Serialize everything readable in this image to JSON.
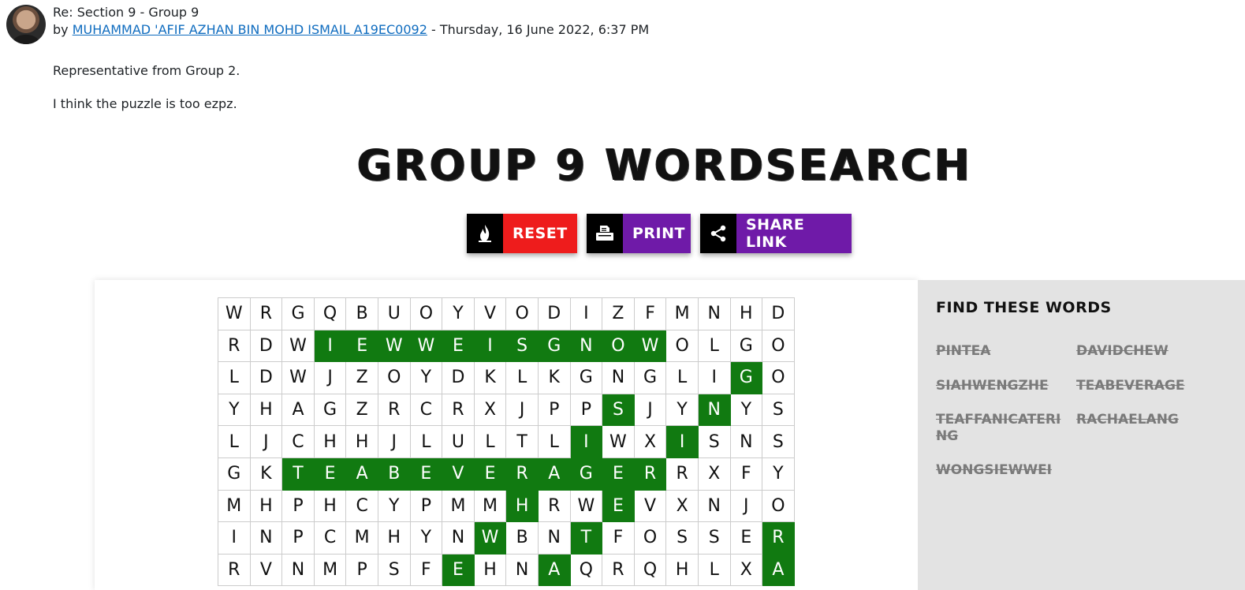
{
  "post": {
    "subject": "Re: Section 9 - Group 9",
    "by_prefix": "by",
    "author": "MUHAMMAD 'AFIF AZHAN BIN MOHD ISMAIL A19EC0092",
    "date": "- Thursday, 16 June 2022, 6:37 PM",
    "paragraphs": [
      "Representative from Group 2.",
      "I think the puzzle is too ezpz."
    ]
  },
  "wordsearch": {
    "title": "GROUP 9 WORDSEARCH",
    "buttons": {
      "reset": {
        "label": "RESET",
        "icon": "fire-icon",
        "color": "#ee1c1c"
      },
      "print": {
        "label": "PRINT",
        "icon": "printer-icon",
        "color": "#6f1aa8"
      },
      "share": {
        "label": "SHARE LINK",
        "icon": "share-icon",
        "color": "#6f1aa8"
      }
    },
    "highlight_color": "#117a11",
    "grid": [
      "WRGQBUOYVODIZFMNHD",
      "RDWIEWWEISGNOWOLGO",
      "LDWJZOYDKLKGNGLIGO",
      "YHAGZRCRXJPPSJYNYS",
      "LJCHHJLULTLIWXISNS",
      "GKTEABEVERAGERRXFY",
      "MHPHCYPMMHRWEVXNJO",
      "INPCMHYNWBNTFOSSER",
      "RVNMPSFEHNAQRQHLXA"
    ],
    "highlighted": [
      [
        1,
        3
      ],
      [
        1,
        4
      ],
      [
        1,
        5
      ],
      [
        1,
        6
      ],
      [
        1,
        7
      ],
      [
        1,
        8
      ],
      [
        1,
        9
      ],
      [
        1,
        10
      ],
      [
        1,
        11
      ],
      [
        1,
        12
      ],
      [
        1,
        13
      ],
      [
        2,
        16
      ],
      [
        3,
        12
      ],
      [
        3,
        15
      ],
      [
        4,
        11
      ],
      [
        4,
        14
      ],
      [
        5,
        2
      ],
      [
        5,
        3
      ],
      [
        5,
        4
      ],
      [
        5,
        5
      ],
      [
        5,
        6
      ],
      [
        5,
        7
      ],
      [
        5,
        8
      ],
      [
        5,
        9
      ],
      [
        5,
        10
      ],
      [
        5,
        11
      ],
      [
        5,
        12
      ],
      [
        5,
        13
      ],
      [
        6,
        9
      ],
      [
        6,
        12
      ],
      [
        7,
        8
      ],
      [
        7,
        11
      ],
      [
        7,
        17
      ],
      [
        8,
        7
      ],
      [
        8,
        10
      ],
      [
        8,
        17
      ]
    ],
    "find_title": "FIND THESE WORDS",
    "words": [
      "PINTEA",
      "DAVIDCHEW",
      "SIAHWENGZHE",
      "TEABEVERAGE",
      "TEAFFANICATERING",
      "RACHAELANG",
      "WONGSIEWWEI"
    ]
  }
}
